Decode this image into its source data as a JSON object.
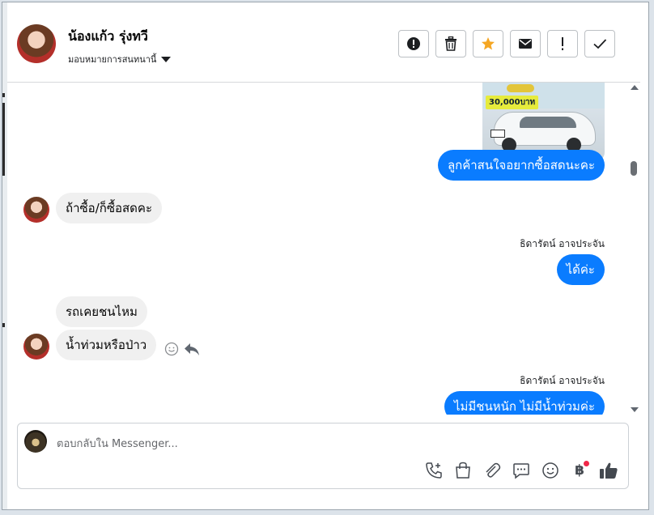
{
  "header": {
    "contact_name": "น้องแก้ว รุ่งทวี",
    "assign_label": "มอบหมายการสนทนานี้"
  },
  "conversation": {
    "image_price_text": "30,000บาท",
    "messages": [
      {
        "direction": "out",
        "text": "ลูกค้าสนใจอยากซื้อสดนะคะ"
      },
      {
        "direction": "in",
        "text": "ถ้าซื้อ/ก็ซื้อสดคะ"
      },
      {
        "direction": "out",
        "sender": "ธิดารัตน์ อาจประจัน",
        "text": "ได้ค่ะ"
      },
      {
        "direction": "in",
        "text": "รถเคยชนไหม"
      },
      {
        "direction": "in",
        "text": "น้ำท่วมหรือป่าว"
      },
      {
        "direction": "out",
        "sender": "ธิดารัตน์ อาจประจัน",
        "text": "ไม่มีชนหนัก ไม่มีน้ำท่วมค่ะ"
      }
    ]
  },
  "composer": {
    "placeholder": "ตอบกลับใน Messenger..."
  },
  "colors": {
    "accent_blue": "#0a7cff",
    "incoming_bubble": "#f0f0f0",
    "star_orange": "#f5a623",
    "notification_dot": "#f02849"
  }
}
